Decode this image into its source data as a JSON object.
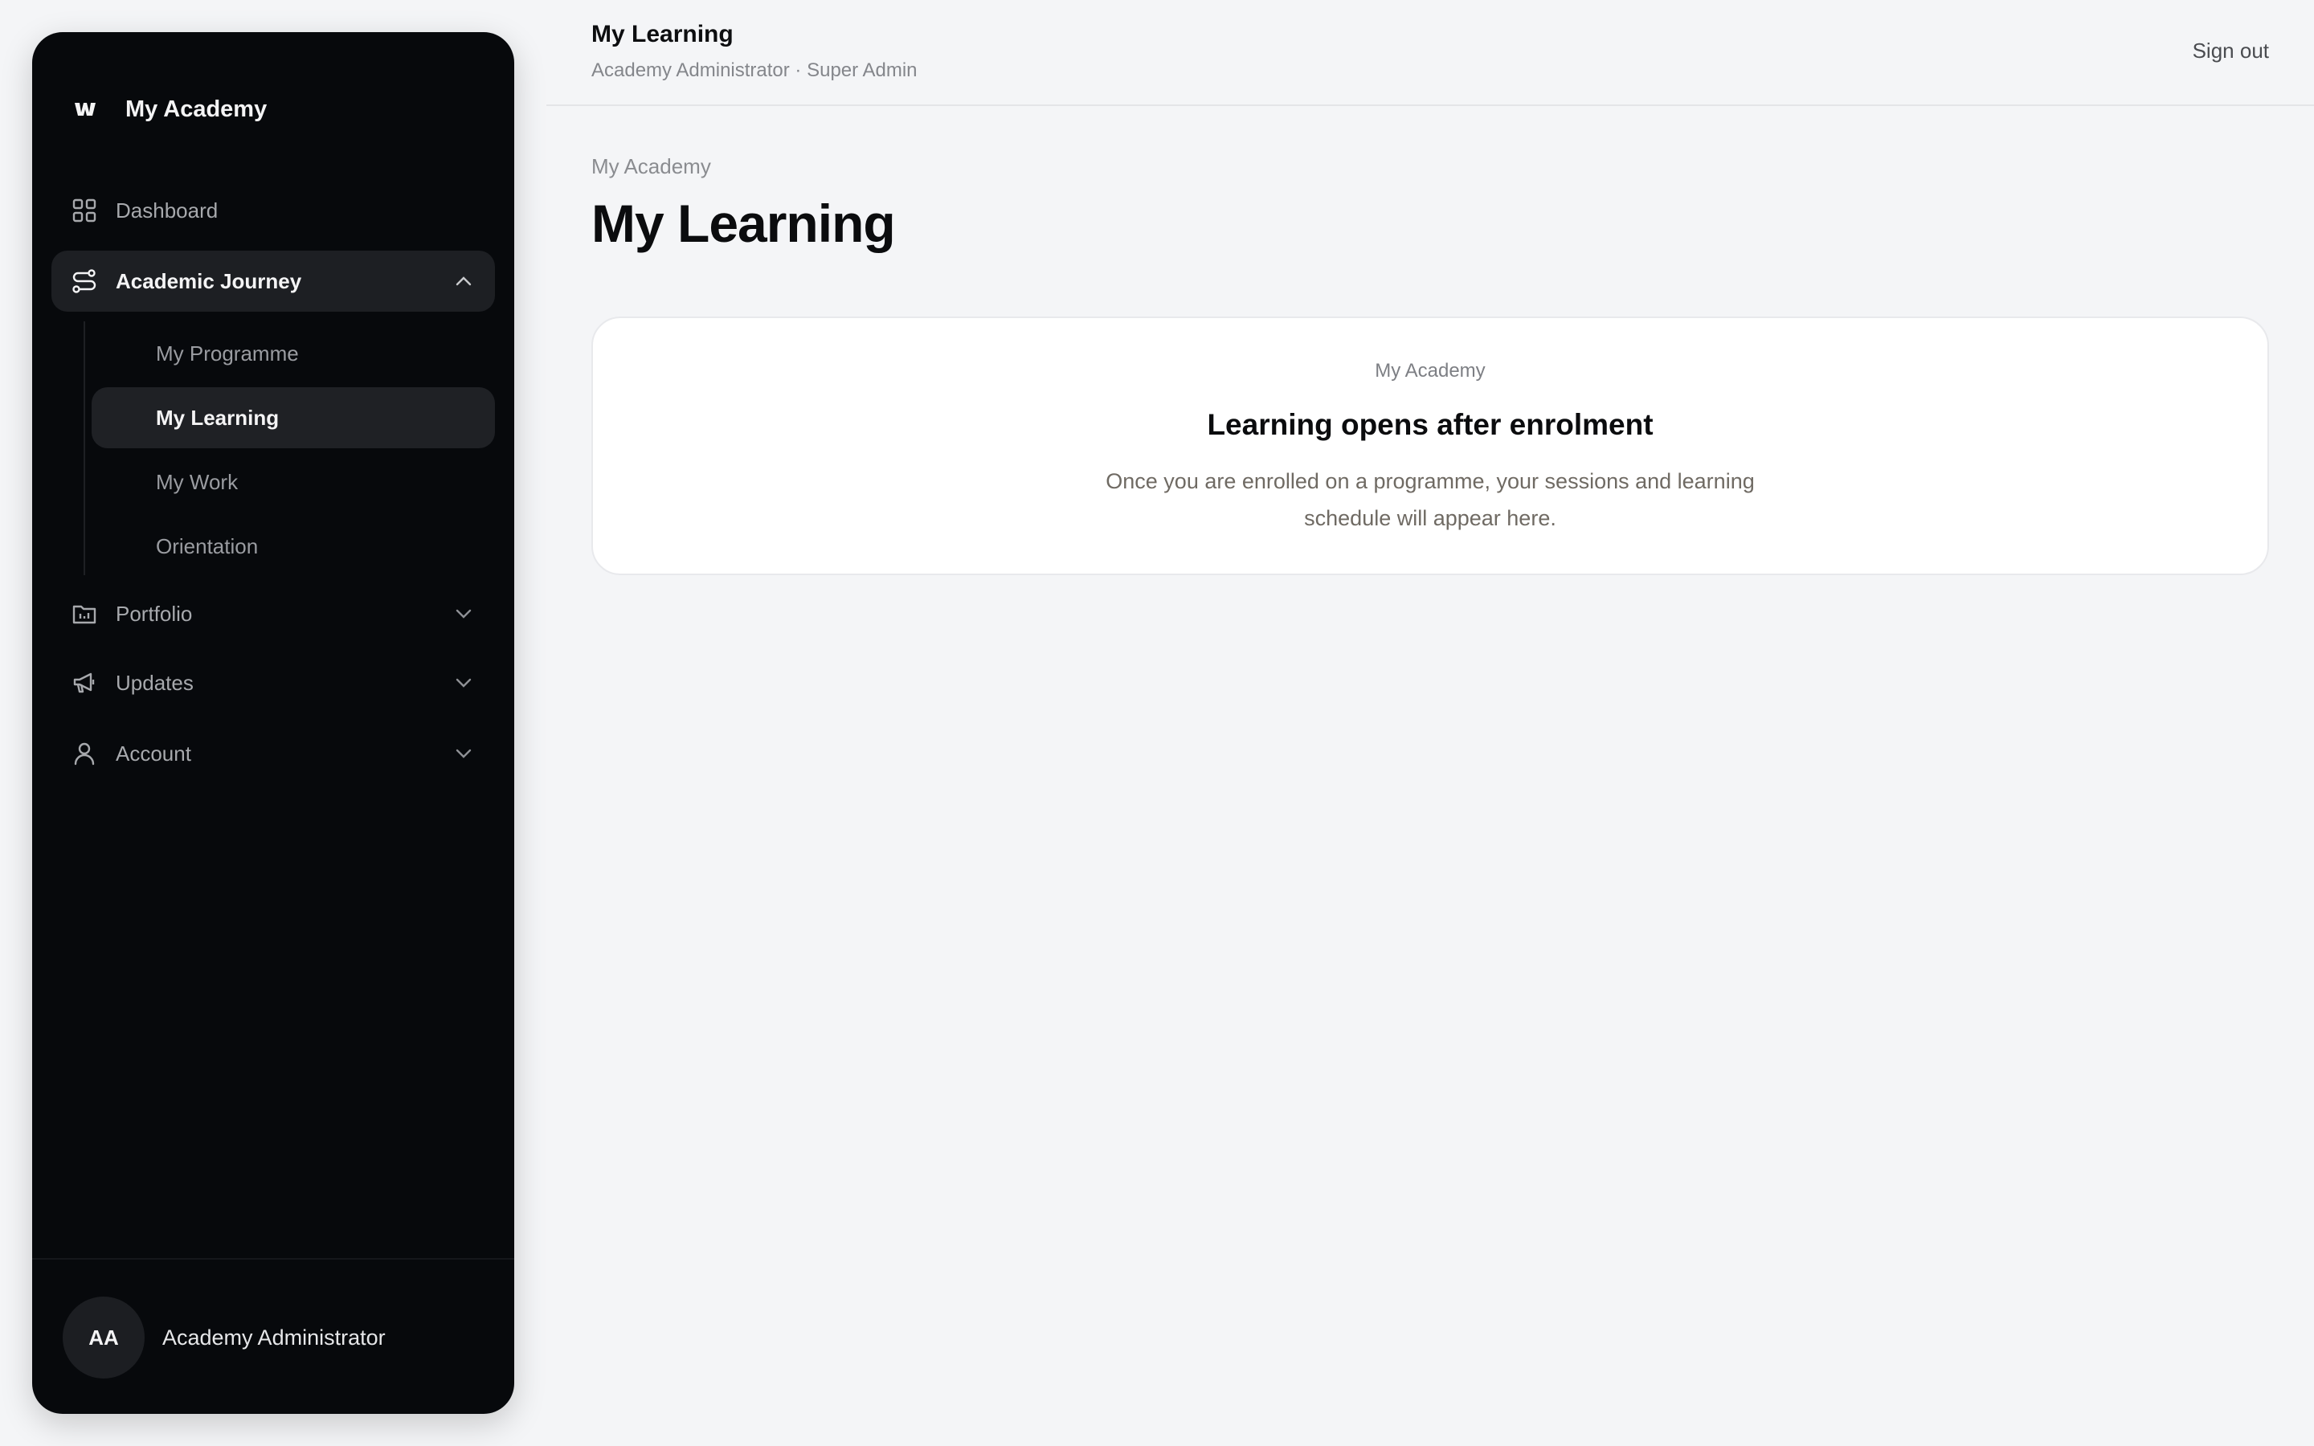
{
  "sidebar": {
    "brand": "My Academy",
    "nav": [
      {
        "label": "Dashboard",
        "icon": "grid-icon"
      },
      {
        "label": "Academic Journey",
        "icon": "route-icon",
        "expanded": true
      },
      {
        "label": "Portfolio",
        "icon": "folder-chart-icon"
      },
      {
        "label": "Updates",
        "icon": "megaphone-icon"
      },
      {
        "label": "Account",
        "icon": "user-icon"
      }
    ],
    "subnav": [
      {
        "label": "My Programme"
      },
      {
        "label": "My Learning",
        "active": true
      },
      {
        "label": "My Work"
      },
      {
        "label": "Orientation"
      }
    ],
    "user": {
      "initials": "AA",
      "name": "Academy Administrator"
    }
  },
  "header": {
    "title": "My Learning",
    "subtitle": "Academy Administrator · Super Admin",
    "signout": "Sign out"
  },
  "main": {
    "breadcrumb": "My Academy",
    "title": "My Learning",
    "card": {
      "eyebrow": "My Academy",
      "title": "Learning opens after enrolment",
      "text": "Once you are enrolled on a programme, your sessions and learning schedule will appear here."
    }
  },
  "colors": {
    "sidebar_bg": "#07090c",
    "active_bg": "#1d1f23",
    "page_bg": "#f4f5f7",
    "card_bg": "#ffffff"
  }
}
